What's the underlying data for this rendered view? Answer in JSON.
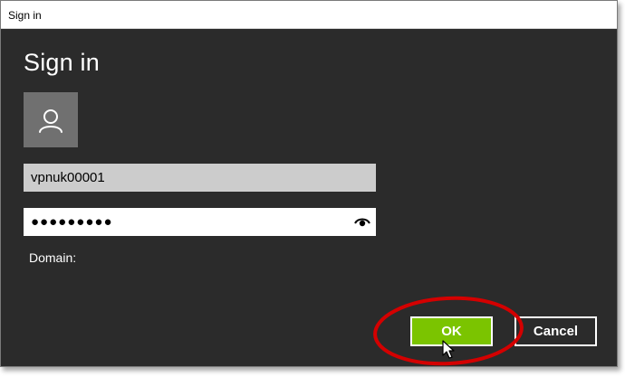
{
  "window": {
    "title": "Sign in"
  },
  "dialog": {
    "heading": "Sign in",
    "avatar_icon": "user-icon",
    "username_value": "vpnuk00001",
    "password_masked": "●●●●●●●●●",
    "reveal_icon": "eye-icon",
    "domain_label": "Domain:"
  },
  "buttons": {
    "ok_label": "OK",
    "cancel_label": "Cancel"
  },
  "colors": {
    "dialog_bg": "#2b2b2b",
    "ok_green": "#7bc400",
    "highlight_red": "#d40000"
  }
}
